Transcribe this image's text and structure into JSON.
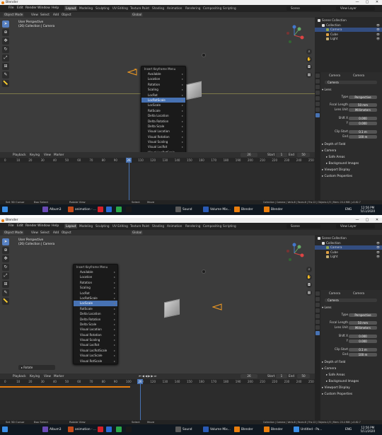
{
  "app": {
    "title": "Blender",
    "win_min": "—",
    "win_max": "▢",
    "win_close": "✕"
  },
  "menus": [
    "File",
    "Edit",
    "Render",
    "Window",
    "Help"
  ],
  "workspaces": [
    "Layout",
    "Modeling",
    "Sculpting",
    "UV Editing",
    "Texture Paint",
    "Shading",
    "Animation",
    "Rendering",
    "Compositing",
    "Scripting"
  ],
  "scene": "Scene",
  "view_layer": "View Layer",
  "viewport_header": {
    "mode": "Object Mode",
    "view": "View",
    "select": "Select",
    "add": "Add",
    "object": "Object",
    "orientation": "Global"
  },
  "top": {
    "info_line1": "User Perspective",
    "info_line2": "(26) Collection | Camera",
    "popup": {
      "title": "Insert Keyframe Menu",
      "items": [
        "Available",
        "Location",
        "Rotation",
        "Scaling",
        "LocRot",
        "LocRotScale",
        "LocScale",
        "RotScale",
        "Delta Location",
        "Delta Rotation",
        "Delta Scale",
        "Visual Location",
        "Visual Rotation",
        "Visual Scaling",
        "Visual LocRot",
        "Visual LocRotScale",
        "Visual LocScale",
        "Visual RotScale"
      ],
      "selected_index": 5
    },
    "current_frame": "26",
    "start": "1",
    "end": "50"
  },
  "bottom": {
    "info_line1": "User Perspective",
    "info_line2": "(26) Collection | Camera",
    "popup": {
      "title": "Insert Keyframe Menu",
      "items": [
        "Available",
        "Location",
        "Rotation",
        "Scaling",
        "LocRot",
        "LocRotScale",
        "LocScale",
        "RotScale",
        "Delta Location",
        "Delta Rotation",
        "Delta Scale",
        "Visual Location",
        "Visual Rotation",
        "Visual Scaling",
        "Visual LocRot",
        "Visual LocRotScale",
        "Visual LocScale",
        "Visual RotScale"
      ],
      "selected_index": 6
    },
    "current_frame": "26",
    "start": "1",
    "end": "50",
    "rotate_panel": "Rotate"
  },
  "timeline": {
    "playback": "Playback",
    "keying": "Keying",
    "view": "View",
    "marker": "Marker",
    "start_label": "Start",
    "end_label": "End"
  },
  "ruler_ticks": [
    "0",
    "10",
    "20",
    "30",
    "40",
    "50",
    "60",
    "70",
    "80",
    "90",
    "100",
    "110",
    "120",
    "130",
    "140",
    "150",
    "160",
    "170",
    "180",
    "190",
    "200",
    "210",
    "220",
    "230",
    "240",
    "250"
  ],
  "outliner": {
    "items": [
      {
        "label": "Scene Collection",
        "indent": 0,
        "selected": false
      },
      {
        "label": "Collection",
        "indent": 1,
        "selected": false
      },
      {
        "label": "Camera",
        "indent": 2,
        "selected": true
      },
      {
        "label": "Cube",
        "indent": 2,
        "selected": false
      },
      {
        "label": "Light",
        "indent": 2,
        "selected": false
      }
    ]
  },
  "properties": {
    "object_name": "Camera",
    "data_name": "Camera",
    "camera_field": "Camera",
    "lens_section": "Lens",
    "type_label": "Type",
    "type_value": "Perspective",
    "focal_label": "Focal Length",
    "focal_value": "50 mm",
    "lens_unit_label": "Lens Unit",
    "lens_unit_value": "Millimeters",
    "shift_x_label": "Shift X",
    "shift_x_value": "0.000",
    "shift_y_label": "Y",
    "shift_y_value": "0.000",
    "clip_start_label": "Clip Start",
    "clip_start_value": "0.1 m",
    "clip_end_label": "End",
    "clip_end_value": "100 m",
    "sections": [
      "Depth of Field",
      "Camera",
      "Safe Areas",
      "Background Images",
      "Viewport Display",
      "Custom Properties"
    ]
  },
  "status": {
    "left": "Set 3D Cursor",
    "mid1": "Box Select",
    "mid2": "Rotate View",
    "mid3": "Select",
    "mid4": "Move",
    "right": "Collection | Camera | Verts:8 | Faces:6 | Tris:12 | Objects:1/3 | Mem: 20.4 MiB | v2.82.7"
  },
  "taskbar": {
    "items": [
      "Album3",
      "animation - ...",
      "",
      "",
      "",
      "",
      "Sound",
      "Volume Mix...",
      "Blender",
      "Blender"
    ],
    "bottom_extra": "Untitled - Pa...",
    "time": "12:56 PM",
    "date": "5/11/2020",
    "lang": "ENG"
  },
  "colors": {
    "accent": "#4772b3",
    "orange": "#e87d0d",
    "bg": "#3c3c3c"
  }
}
